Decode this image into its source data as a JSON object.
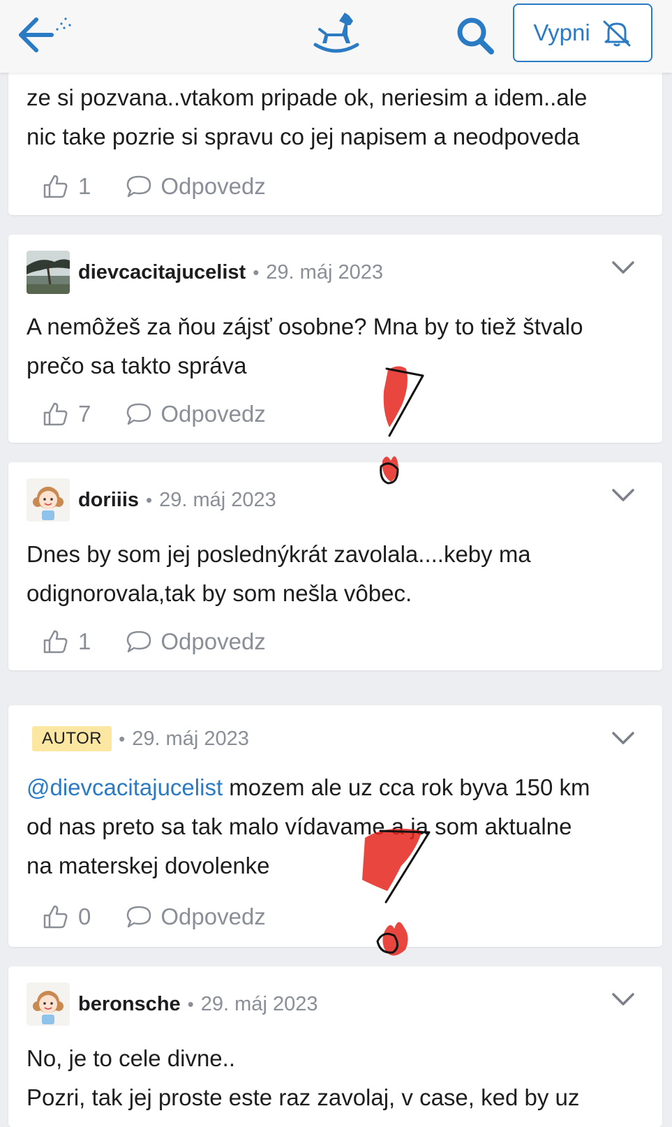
{
  "topbar": {
    "back_icon": "back-arrow-icon",
    "logo_icon": "rocking-horse-icon",
    "search_icon": "search-icon",
    "mute_label": "Vypni",
    "mute_icon": "bell-off-icon"
  },
  "colors": {
    "accent": "#2b7bc4",
    "muted": "#8a8e96",
    "badge_bg": "#fbe7a2",
    "annotation_red": "#e5261f"
  },
  "posts": [
    {
      "text_lines": [
        "ze si pozvana..vtakom pripade ok, neriesim a idem..ale",
        "nic take pozrie si spravu co jej napisem a neodpoveda"
      ],
      "likes": "1",
      "reply_label": "Odpovedz"
    },
    {
      "author": "dievcacitajucelist",
      "date": "29. máj 2023",
      "text_lines": [
        "A nemôžeš za ňou zájsť osobne? Mna by to tiež štvalo",
        "prečo sa takto správa"
      ],
      "likes": "7",
      "reply_label": "Odpovedz"
    },
    {
      "author": "doriiis",
      "date": "29. máj 2023",
      "text_lines": [
        "Dnes by som jej poslednýkrát zavolala....keby ma",
        "odignorovala,tak by som nešla vôbec."
      ],
      "likes": "1",
      "reply_label": "Odpovedz"
    },
    {
      "badge": "AUTOR",
      "date": "29. máj 2023",
      "mention": "@dievcacitajucelist",
      "text_first_rest": " mozem ale uz cca rok byva 150 km",
      "text_lines": [
        "od nas preto sa tak malo vídavame a ja som aktualne",
        "na materskej dovolenke"
      ],
      "likes": "0",
      "reply_label": "Odpovedz"
    },
    {
      "author": "beronsche",
      "date": "29. máj 2023",
      "text_lines": [
        "No, je to cele divne..",
        "Pozri, tak jej proste este raz zavolaj, v case, ked by uz"
      ]
    }
  ]
}
